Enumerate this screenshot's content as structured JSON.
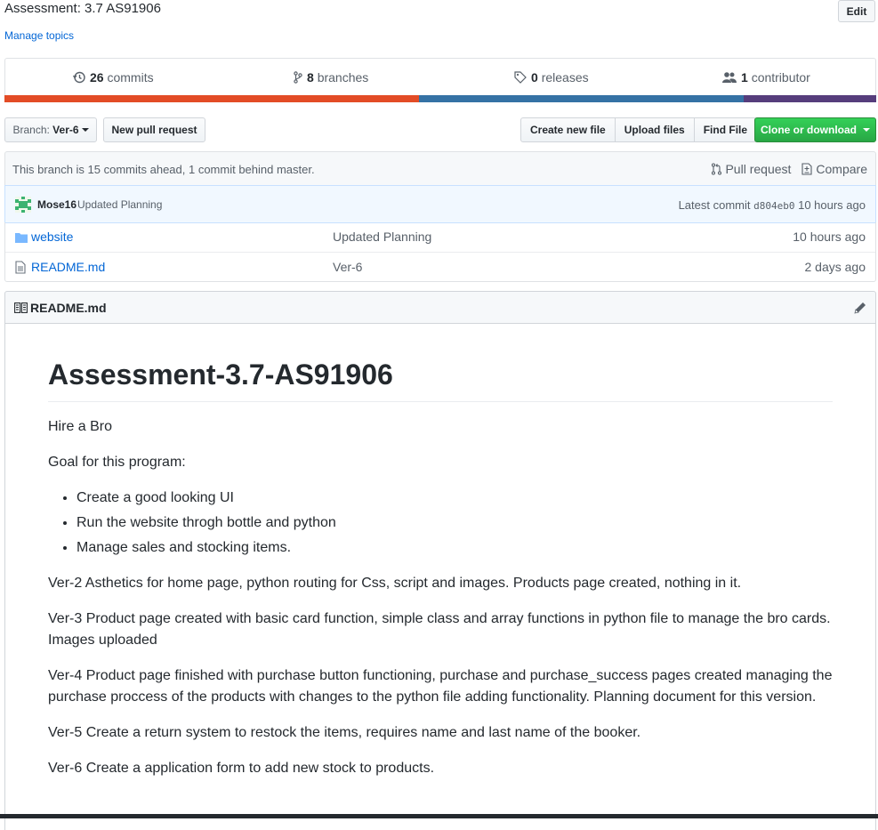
{
  "repo": {
    "description": "Assessment: 3.7 AS91906",
    "manage_topics": "Manage topics",
    "edit_label": "Edit"
  },
  "summary": {
    "commits_count": "26",
    "commits_label": "commits",
    "branches_count": "8",
    "branches_label": "branches",
    "releases_count": "0",
    "releases_label": "releases",
    "contributors_count": "1",
    "contributors_label": "contributor"
  },
  "language_bar": {
    "colors": [
      "#e34c26",
      "#3572A5",
      "#563d7c"
    ]
  },
  "toolbar": {
    "branch_prefix": "Branch:",
    "branch_name": "Ver-6",
    "new_pull_request": "New pull request",
    "create_new_file": "Create new file",
    "upload_files": "Upload files",
    "find_file": "Find File",
    "clone_or_download": "Clone or download"
  },
  "branch_info": {
    "text": "This branch is 15 commits ahead, 1 commit behind master.",
    "pull_request": "Pull request",
    "compare": "Compare"
  },
  "latest_commit": {
    "author": "Mose16",
    "message": "Updated Planning",
    "latest_label": "Latest commit",
    "sha": "d804eb0",
    "age": "10 hours ago"
  },
  "files": [
    {
      "name": "website",
      "icon": "folder-icon",
      "message": "Updated Planning",
      "age": "10 hours ago"
    },
    {
      "name": "README.md",
      "icon": "file-icon",
      "message": "Ver-6",
      "age": "2 days ago"
    }
  ],
  "readme": {
    "header_title": "README.md",
    "title": "Assessment-3.7-AS91906",
    "intro": "Hire a Bro",
    "goal": "Goal for this program:",
    "goals": [
      "Create a good looking UI",
      "Run the website throgh bottle and python",
      "Manage sales and stocking items."
    ],
    "versions": [
      "Ver-2 Asthetics for home page, python routing for Css, script and images. Products page created, nothing in it.",
      "Ver-3 Product page created with basic card function, simple class and array functions in python file to manage the bro cards. Images uploaded",
      "Ver-4 Product page finished with purchase button functioning, purchase and purchase_success pages created managing the purchase proccess of the products with changes to the python file adding functionality. Planning document for this version.",
      "Ver-5 Create a return system to restock the items, requires name and last name of the booker.",
      "Ver-6 Create a application form to add new stock to products."
    ]
  }
}
